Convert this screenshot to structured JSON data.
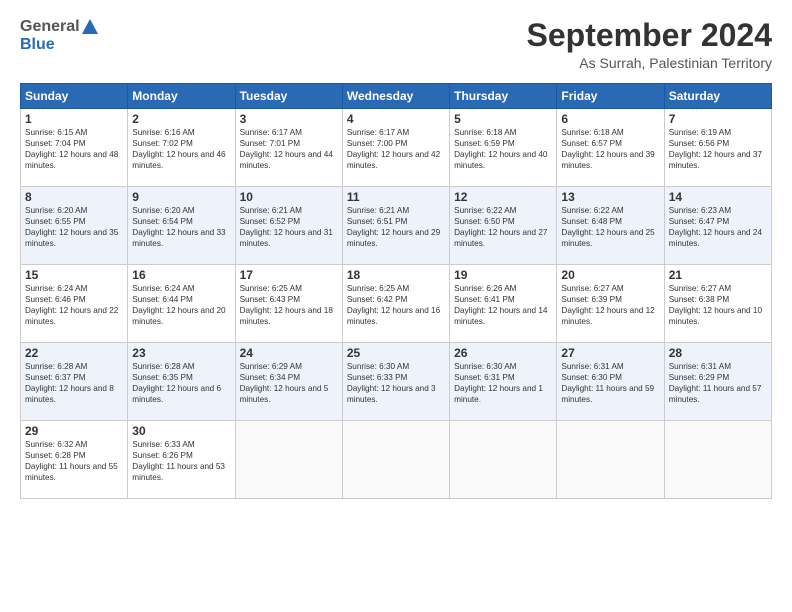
{
  "header": {
    "logo_general": "General",
    "logo_blue": "Blue",
    "month": "September 2024",
    "location": "As Surrah, Palestinian Territory"
  },
  "days_of_week": [
    "Sunday",
    "Monday",
    "Tuesday",
    "Wednesday",
    "Thursday",
    "Friday",
    "Saturday"
  ],
  "weeks": [
    [
      {
        "day": "1",
        "sunrise": "Sunrise: 6:15 AM",
        "sunset": "Sunset: 7:04 PM",
        "daylight": "Daylight: 12 hours and 48 minutes."
      },
      {
        "day": "2",
        "sunrise": "Sunrise: 6:16 AM",
        "sunset": "Sunset: 7:02 PM",
        "daylight": "Daylight: 12 hours and 46 minutes."
      },
      {
        "day": "3",
        "sunrise": "Sunrise: 6:17 AM",
        "sunset": "Sunset: 7:01 PM",
        "daylight": "Daylight: 12 hours and 44 minutes."
      },
      {
        "day": "4",
        "sunrise": "Sunrise: 6:17 AM",
        "sunset": "Sunset: 7:00 PM",
        "daylight": "Daylight: 12 hours and 42 minutes."
      },
      {
        "day": "5",
        "sunrise": "Sunrise: 6:18 AM",
        "sunset": "Sunset: 6:59 PM",
        "daylight": "Daylight: 12 hours and 40 minutes."
      },
      {
        "day": "6",
        "sunrise": "Sunrise: 6:18 AM",
        "sunset": "Sunset: 6:57 PM",
        "daylight": "Daylight: 12 hours and 39 minutes."
      },
      {
        "day": "7",
        "sunrise": "Sunrise: 6:19 AM",
        "sunset": "Sunset: 6:56 PM",
        "daylight": "Daylight: 12 hours and 37 minutes."
      }
    ],
    [
      {
        "day": "8",
        "sunrise": "Sunrise: 6:20 AM",
        "sunset": "Sunset: 6:55 PM",
        "daylight": "Daylight: 12 hours and 35 minutes."
      },
      {
        "day": "9",
        "sunrise": "Sunrise: 6:20 AM",
        "sunset": "Sunset: 6:54 PM",
        "daylight": "Daylight: 12 hours and 33 minutes."
      },
      {
        "day": "10",
        "sunrise": "Sunrise: 6:21 AM",
        "sunset": "Sunset: 6:52 PM",
        "daylight": "Daylight: 12 hours and 31 minutes."
      },
      {
        "day": "11",
        "sunrise": "Sunrise: 6:21 AM",
        "sunset": "Sunset: 6:51 PM",
        "daylight": "Daylight: 12 hours and 29 minutes."
      },
      {
        "day": "12",
        "sunrise": "Sunrise: 6:22 AM",
        "sunset": "Sunset: 6:50 PM",
        "daylight": "Daylight: 12 hours and 27 minutes."
      },
      {
        "day": "13",
        "sunrise": "Sunrise: 6:22 AM",
        "sunset": "Sunset: 6:48 PM",
        "daylight": "Daylight: 12 hours and 25 minutes."
      },
      {
        "day": "14",
        "sunrise": "Sunrise: 6:23 AM",
        "sunset": "Sunset: 6:47 PM",
        "daylight": "Daylight: 12 hours and 24 minutes."
      }
    ],
    [
      {
        "day": "15",
        "sunrise": "Sunrise: 6:24 AM",
        "sunset": "Sunset: 6:46 PM",
        "daylight": "Daylight: 12 hours and 22 minutes."
      },
      {
        "day": "16",
        "sunrise": "Sunrise: 6:24 AM",
        "sunset": "Sunset: 6:44 PM",
        "daylight": "Daylight: 12 hours and 20 minutes."
      },
      {
        "day": "17",
        "sunrise": "Sunrise: 6:25 AM",
        "sunset": "Sunset: 6:43 PM",
        "daylight": "Daylight: 12 hours and 18 minutes."
      },
      {
        "day": "18",
        "sunrise": "Sunrise: 6:25 AM",
        "sunset": "Sunset: 6:42 PM",
        "daylight": "Daylight: 12 hours and 16 minutes."
      },
      {
        "day": "19",
        "sunrise": "Sunrise: 6:26 AM",
        "sunset": "Sunset: 6:41 PM",
        "daylight": "Daylight: 12 hours and 14 minutes."
      },
      {
        "day": "20",
        "sunrise": "Sunrise: 6:27 AM",
        "sunset": "Sunset: 6:39 PM",
        "daylight": "Daylight: 12 hours and 12 minutes."
      },
      {
        "day": "21",
        "sunrise": "Sunrise: 6:27 AM",
        "sunset": "Sunset: 6:38 PM",
        "daylight": "Daylight: 12 hours and 10 minutes."
      }
    ],
    [
      {
        "day": "22",
        "sunrise": "Sunrise: 6:28 AM",
        "sunset": "Sunset: 6:37 PM",
        "daylight": "Daylight: 12 hours and 8 minutes."
      },
      {
        "day": "23",
        "sunrise": "Sunrise: 6:28 AM",
        "sunset": "Sunset: 6:35 PM",
        "daylight": "Daylight: 12 hours and 6 minutes."
      },
      {
        "day": "24",
        "sunrise": "Sunrise: 6:29 AM",
        "sunset": "Sunset: 6:34 PM",
        "daylight": "Daylight: 12 hours and 5 minutes."
      },
      {
        "day": "25",
        "sunrise": "Sunrise: 6:30 AM",
        "sunset": "Sunset: 6:33 PM",
        "daylight": "Daylight: 12 hours and 3 minutes."
      },
      {
        "day": "26",
        "sunrise": "Sunrise: 6:30 AM",
        "sunset": "Sunset: 6:31 PM",
        "daylight": "Daylight: 12 hours and 1 minute."
      },
      {
        "day": "27",
        "sunrise": "Sunrise: 6:31 AM",
        "sunset": "Sunset: 6:30 PM",
        "daylight": "Daylight: 11 hours and 59 minutes."
      },
      {
        "day": "28",
        "sunrise": "Sunrise: 6:31 AM",
        "sunset": "Sunset: 6:29 PM",
        "daylight": "Daylight: 11 hours and 57 minutes."
      }
    ],
    [
      {
        "day": "29",
        "sunrise": "Sunrise: 6:32 AM",
        "sunset": "Sunset: 6:28 PM",
        "daylight": "Daylight: 11 hours and 55 minutes."
      },
      {
        "day": "30",
        "sunrise": "Sunrise: 6:33 AM",
        "sunset": "Sunset: 6:26 PM",
        "daylight": "Daylight: 11 hours and 53 minutes."
      },
      {
        "day": "",
        "sunrise": "",
        "sunset": "",
        "daylight": ""
      },
      {
        "day": "",
        "sunrise": "",
        "sunset": "",
        "daylight": ""
      },
      {
        "day": "",
        "sunrise": "",
        "sunset": "",
        "daylight": ""
      },
      {
        "day": "",
        "sunrise": "",
        "sunset": "",
        "daylight": ""
      },
      {
        "day": "",
        "sunrise": "",
        "sunset": "",
        "daylight": ""
      }
    ]
  ]
}
